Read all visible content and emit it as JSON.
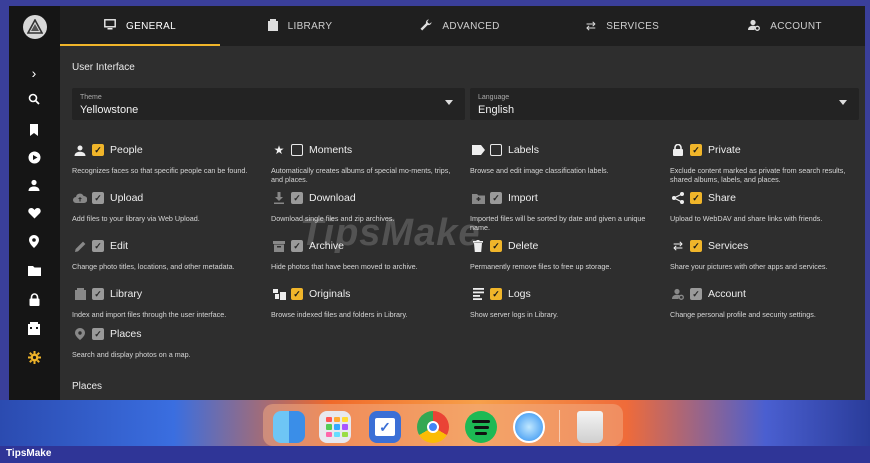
{
  "tabs": [
    {
      "label": "GENERAL",
      "icon": "monitor-icon"
    },
    {
      "label": "LIBRARY",
      "icon": "film-icon"
    },
    {
      "label": "ADVANCED",
      "icon": "wrench-icon"
    },
    {
      "label": "SERVICES",
      "icon": "swap-icon"
    },
    {
      "label": "ACCOUNT",
      "icon": "user-cog-icon"
    }
  ],
  "sections": {
    "ui": "User Interface",
    "places": "Places"
  },
  "theme": {
    "label": "Theme",
    "value": "Yellowstone"
  },
  "language": {
    "label": "Language",
    "value": "English"
  },
  "options": [
    {
      "name": "People",
      "desc": "Recognizes faces so that specific people can be found.",
      "state": "on",
      "icon": "person-icon"
    },
    {
      "name": "Moments",
      "desc": "Automatically creates albums of special mo-ments, trips, and places.",
      "state": "off",
      "icon": "star-icon"
    },
    {
      "name": "Labels",
      "desc": "Browse and edit image classification labels.",
      "state": "off",
      "icon": "label-icon"
    },
    {
      "name": "Private",
      "desc": "Exclude content marked as private from search results, shared albums, labels, and places.",
      "state": "on",
      "icon": "lock-icon"
    },
    {
      "name": "Upload",
      "desc": "Add files to your library via Web Upload.",
      "state": "grey",
      "icon": "cloud-upload-icon"
    },
    {
      "name": "Download",
      "desc": "Download single files and zip archives.",
      "state": "grey",
      "icon": "download-icon"
    },
    {
      "name": "Import",
      "desc": "Imported files will be sorted by date and given a unique name.",
      "state": "grey",
      "icon": "import-icon"
    },
    {
      "name": "Share",
      "desc": "Upload to WebDAV and share links with friends.",
      "state": "on",
      "icon": "share-icon"
    },
    {
      "name": "Edit",
      "desc": "Change photo titles, locations, and other metadata.",
      "state": "grey",
      "icon": "pencil-icon"
    },
    {
      "name": "Archive",
      "desc": "Hide photos that have been moved to archive.",
      "state": "grey",
      "icon": "archive-icon"
    },
    {
      "name": "Delete",
      "desc": "Permanently remove files to free up storage.",
      "state": "on",
      "icon": "trash-icon"
    },
    {
      "name": "Services",
      "desc": "Share your pictures with other apps and services.",
      "state": "on",
      "icon": "swap-icon"
    },
    {
      "name": "Library",
      "desc": "Index and import files through the user interface.",
      "state": "grey",
      "icon": "film-icon"
    },
    {
      "name": "Originals",
      "desc": "Browse indexed files and folders in Library.",
      "state": "on",
      "icon": "folders-icon"
    },
    {
      "name": "Logs",
      "desc": "Show server logs in Library.",
      "state": "on",
      "icon": "logs-icon"
    },
    {
      "name": "Account",
      "desc": "Change personal profile and security settings.",
      "state": "grey",
      "icon": "user-cog-icon"
    },
    {
      "name": "Places",
      "desc": "Search and display photos on a map.",
      "state": "grey",
      "icon": "pin-icon"
    }
  ],
  "watermark": "TipsMake",
  "footer_brand": "TipsMake"
}
